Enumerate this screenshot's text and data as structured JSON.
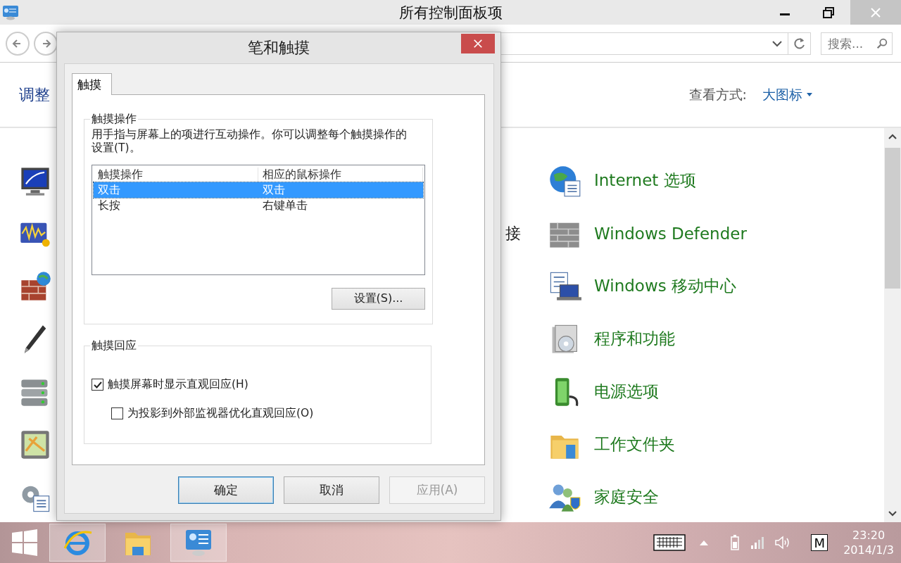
{
  "window": {
    "title": "所有控制面板项",
    "search": {
      "placeholder": "搜索..."
    },
    "heading": "调整",
    "view_label": "查看方式:",
    "view_value": "大图标"
  },
  "items": [
    {
      "label": "Internet 选项"
    },
    {
      "label": "Windows Defender",
      "middle_text": "接"
    },
    {
      "label": "Windows 移动中心"
    },
    {
      "label": "程序和功能"
    },
    {
      "label": "电源选项"
    },
    {
      "label": "工作文件夹"
    },
    {
      "label": "家庭安全"
    }
  ],
  "dialog": {
    "title": "笔和触摸",
    "tabs": [
      {
        "label": "触摸",
        "selected": true
      }
    ],
    "actions_group": {
      "title": "触摸操作",
      "description": "用手指与屏幕上的项进行互动操作。你可以调整每个触摸操作的设置(T)。",
      "columns": [
        "触摸操作",
        "相应的鼠标操作"
      ],
      "rows": [
        {
          "cells": [
            "双击",
            "双击"
          ],
          "selected": true
        },
        {
          "cells": [
            "长按",
            "右键单击"
          ],
          "selected": false
        }
      ],
      "button": "设置(S)..."
    },
    "feedback_group": {
      "title": "触摸回应",
      "checkboxes": [
        {
          "label": "触摸屏幕时显示直观回应(H)",
          "checked": true,
          "children": [
            {
              "label": "为投影到外部监视器优化直观回应(O)",
              "checked": false
            }
          ]
        }
      ]
    },
    "buttons": [
      {
        "label": "确定",
        "kind": "default",
        "disabled": false
      },
      {
        "label": "取消",
        "kind": "normal",
        "disabled": false
      },
      {
        "label": "应用(A)",
        "kind": "normal",
        "disabled": true
      }
    ]
  },
  "taskbar": {
    "apps": [
      {
        "running": true
      },
      {
        "running": false
      },
      {
        "running": true
      }
    ],
    "ime": "M",
    "time": "23:20",
    "date": "2014/1/3"
  }
}
